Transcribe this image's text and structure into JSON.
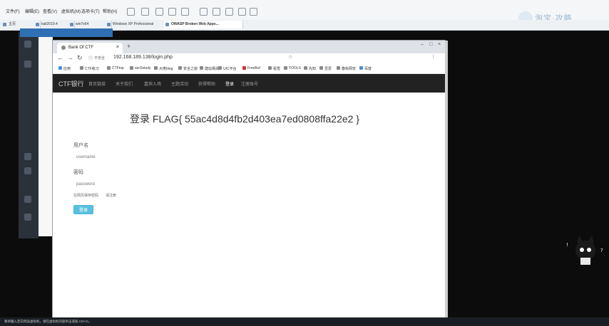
{
  "host": {
    "menu": [
      "文件(F)",
      "编辑(E)",
      "查看(V)",
      "虚拟机(M)",
      "选项卡(T)",
      "帮助(H)"
    ],
    "tabs": [
      {
        "label": "主页",
        "color": "#6a8fb5"
      },
      {
        "label": "kali2019.4",
        "color": "#6a8fb5"
      },
      {
        "label": "win7x64",
        "color": "#6a8fb5"
      },
      {
        "label": "Windows XP Professional",
        "color": "#6a8fb5"
      },
      {
        "label": "OWASP Broken Web Apps...",
        "color": "#6a8fb5"
      }
    ],
    "watermark": "淘宝·攻略"
  },
  "browser": {
    "tab_title": "Bank Of CTF",
    "address": "192.168.189.138/login.php",
    "security_label": "不安全",
    "bookmarks": [
      "应用",
      "CTF练习",
      "CTFtop",
      "sec5study",
      "大佬blog",
      "安全之窗",
      "建站相关",
      "UIC平台",
      "FreeBuf",
      "看雪",
      "TOOLS",
      "先知",
      "吾爱",
      "春秋网安",
      "百度"
    ]
  },
  "navbar": {
    "brand": "CTF银行",
    "items": [
      "首页链接",
      "关于我们",
      "嘉宾入场",
      "主题活动",
      "获得帮助",
      "登录",
      "注册账号"
    ]
  },
  "login": {
    "title": "登录 FLAG{ 55ac4d8d4fb2d403ea7ed0808ffa22e2 }",
    "username_label": "用户名",
    "username_placeholder": "username",
    "password_label": "密码",
    "password_placeholder": "password",
    "hint": "在网页保存密码",
    "hint_link": "请注册",
    "submit_label": "登录"
  },
  "taskbar": {
    "text": "要将输入定向到该虚拟机，请在虚拟机内部单击或按 Ctrl+G。"
  }
}
